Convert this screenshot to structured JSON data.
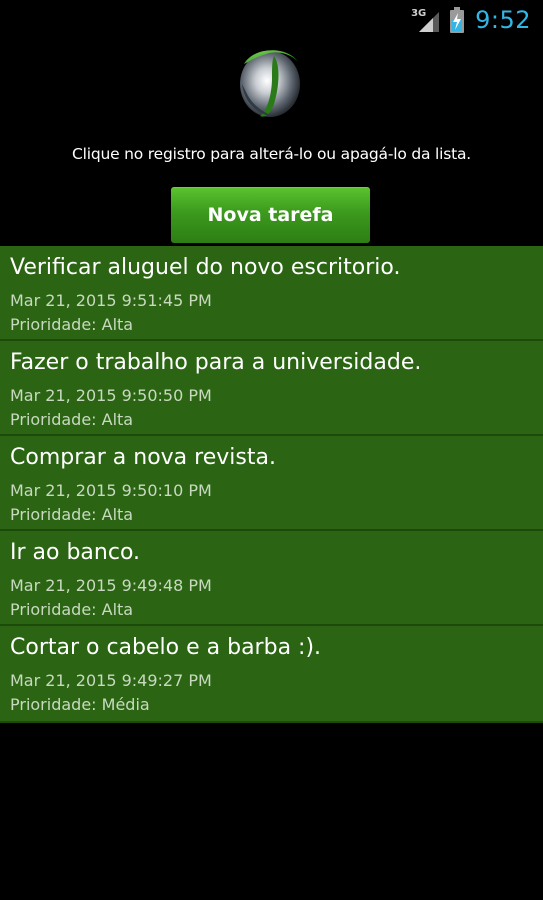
{
  "status_bar": {
    "network_type": "3G",
    "time": "9:52"
  },
  "header": {
    "logo": "app-logo",
    "instruction": "Clique no registro para alterá-lo ou apagá-lo da lista.",
    "new_task_label": "Nova tarefa"
  },
  "colors": {
    "item_background": "#2b6513",
    "button_green": "#3c9a1d",
    "clock_blue": "#33b5e5"
  },
  "tasks": [
    {
      "title": "Verificar aluguel do novo escritorio.",
      "date": "Mar 21, 2015 9:51:45 PM",
      "priority": "Prioridade: Alta"
    },
    {
      "title": "Fazer o trabalho para a universidade.",
      "date": "Mar 21, 2015 9:50:50 PM",
      "priority": "Prioridade: Alta"
    },
    {
      "title": "Comprar a nova revista.",
      "date": "Mar 21, 2015 9:50:10 PM",
      "priority": "Prioridade: Alta"
    },
    {
      "title": "Ir ao banco.",
      "date": "Mar 21, 2015 9:49:48 PM",
      "priority": "Prioridade: Alta"
    },
    {
      "title": "Cortar o cabelo e a barba :).",
      "date": "Mar 21, 2015 9:49:27 PM",
      "priority": "Prioridade: Média"
    }
  ]
}
